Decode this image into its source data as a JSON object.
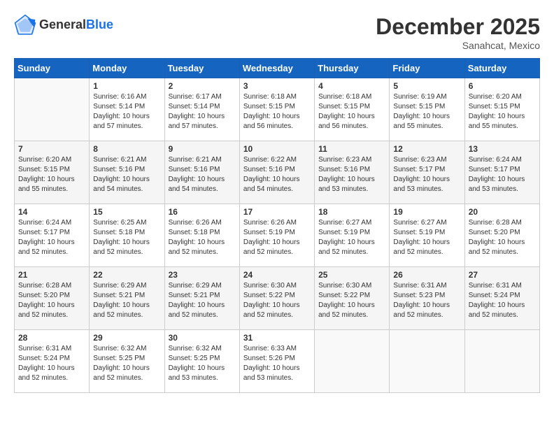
{
  "header": {
    "logo_line1": "General",
    "logo_line2": "Blue",
    "month": "December 2025",
    "location": "Sanahcat, Mexico"
  },
  "days_of_week": [
    "Sunday",
    "Monday",
    "Tuesday",
    "Wednesday",
    "Thursday",
    "Friday",
    "Saturday"
  ],
  "weeks": [
    [
      {
        "num": "",
        "info": ""
      },
      {
        "num": "1",
        "info": "Sunrise: 6:16 AM\nSunset: 5:14 PM\nDaylight: 10 hours\nand 57 minutes."
      },
      {
        "num": "2",
        "info": "Sunrise: 6:17 AM\nSunset: 5:14 PM\nDaylight: 10 hours\nand 57 minutes."
      },
      {
        "num": "3",
        "info": "Sunrise: 6:18 AM\nSunset: 5:15 PM\nDaylight: 10 hours\nand 56 minutes."
      },
      {
        "num": "4",
        "info": "Sunrise: 6:18 AM\nSunset: 5:15 PM\nDaylight: 10 hours\nand 56 minutes."
      },
      {
        "num": "5",
        "info": "Sunrise: 6:19 AM\nSunset: 5:15 PM\nDaylight: 10 hours\nand 55 minutes."
      },
      {
        "num": "6",
        "info": "Sunrise: 6:20 AM\nSunset: 5:15 PM\nDaylight: 10 hours\nand 55 minutes."
      }
    ],
    [
      {
        "num": "7",
        "info": "Sunrise: 6:20 AM\nSunset: 5:15 PM\nDaylight: 10 hours\nand 55 minutes."
      },
      {
        "num": "8",
        "info": "Sunrise: 6:21 AM\nSunset: 5:16 PM\nDaylight: 10 hours\nand 54 minutes."
      },
      {
        "num": "9",
        "info": "Sunrise: 6:21 AM\nSunset: 5:16 PM\nDaylight: 10 hours\nand 54 minutes."
      },
      {
        "num": "10",
        "info": "Sunrise: 6:22 AM\nSunset: 5:16 PM\nDaylight: 10 hours\nand 54 minutes."
      },
      {
        "num": "11",
        "info": "Sunrise: 6:23 AM\nSunset: 5:16 PM\nDaylight: 10 hours\nand 53 minutes."
      },
      {
        "num": "12",
        "info": "Sunrise: 6:23 AM\nSunset: 5:17 PM\nDaylight: 10 hours\nand 53 minutes."
      },
      {
        "num": "13",
        "info": "Sunrise: 6:24 AM\nSunset: 5:17 PM\nDaylight: 10 hours\nand 53 minutes."
      }
    ],
    [
      {
        "num": "14",
        "info": "Sunrise: 6:24 AM\nSunset: 5:17 PM\nDaylight: 10 hours\nand 52 minutes."
      },
      {
        "num": "15",
        "info": "Sunrise: 6:25 AM\nSunset: 5:18 PM\nDaylight: 10 hours\nand 52 minutes."
      },
      {
        "num": "16",
        "info": "Sunrise: 6:26 AM\nSunset: 5:18 PM\nDaylight: 10 hours\nand 52 minutes."
      },
      {
        "num": "17",
        "info": "Sunrise: 6:26 AM\nSunset: 5:19 PM\nDaylight: 10 hours\nand 52 minutes."
      },
      {
        "num": "18",
        "info": "Sunrise: 6:27 AM\nSunset: 5:19 PM\nDaylight: 10 hours\nand 52 minutes."
      },
      {
        "num": "19",
        "info": "Sunrise: 6:27 AM\nSunset: 5:19 PM\nDaylight: 10 hours\nand 52 minutes."
      },
      {
        "num": "20",
        "info": "Sunrise: 6:28 AM\nSunset: 5:20 PM\nDaylight: 10 hours\nand 52 minutes."
      }
    ],
    [
      {
        "num": "21",
        "info": "Sunrise: 6:28 AM\nSunset: 5:20 PM\nDaylight: 10 hours\nand 52 minutes."
      },
      {
        "num": "22",
        "info": "Sunrise: 6:29 AM\nSunset: 5:21 PM\nDaylight: 10 hours\nand 52 minutes."
      },
      {
        "num": "23",
        "info": "Sunrise: 6:29 AM\nSunset: 5:21 PM\nDaylight: 10 hours\nand 52 minutes."
      },
      {
        "num": "24",
        "info": "Sunrise: 6:30 AM\nSunset: 5:22 PM\nDaylight: 10 hours\nand 52 minutes."
      },
      {
        "num": "25",
        "info": "Sunrise: 6:30 AM\nSunset: 5:22 PM\nDaylight: 10 hours\nand 52 minutes."
      },
      {
        "num": "26",
        "info": "Sunrise: 6:31 AM\nSunset: 5:23 PM\nDaylight: 10 hours\nand 52 minutes."
      },
      {
        "num": "27",
        "info": "Sunrise: 6:31 AM\nSunset: 5:24 PM\nDaylight: 10 hours\nand 52 minutes."
      }
    ],
    [
      {
        "num": "28",
        "info": "Sunrise: 6:31 AM\nSunset: 5:24 PM\nDaylight: 10 hours\nand 52 minutes."
      },
      {
        "num": "29",
        "info": "Sunrise: 6:32 AM\nSunset: 5:25 PM\nDaylight: 10 hours\nand 52 minutes."
      },
      {
        "num": "30",
        "info": "Sunrise: 6:32 AM\nSunset: 5:25 PM\nDaylight: 10 hours\nand 53 minutes."
      },
      {
        "num": "31",
        "info": "Sunrise: 6:33 AM\nSunset: 5:26 PM\nDaylight: 10 hours\nand 53 minutes."
      },
      {
        "num": "",
        "info": ""
      },
      {
        "num": "",
        "info": ""
      },
      {
        "num": "",
        "info": ""
      }
    ]
  ]
}
